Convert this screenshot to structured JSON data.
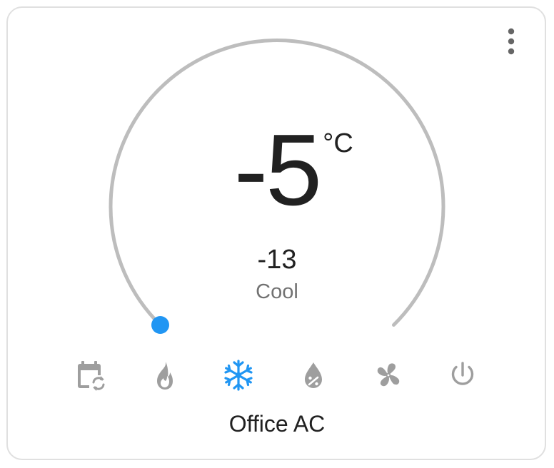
{
  "card": {
    "name": "Office AC"
  },
  "thermostat": {
    "target_temperature": "-5",
    "unit": "°C",
    "current_temperature": "-13",
    "mode_label": "Cool",
    "setpoint_fraction": 0.0
  },
  "modes": [
    {
      "id": "auto",
      "icon": "calendar-sync-icon",
      "active": false
    },
    {
      "id": "heat",
      "icon": "fire-icon",
      "active": false
    },
    {
      "id": "cool",
      "icon": "snowflake-icon",
      "active": true
    },
    {
      "id": "dry",
      "icon": "water-percent-icon",
      "active": false
    },
    {
      "id": "fan_only",
      "icon": "fan-icon",
      "active": false
    },
    {
      "id": "off",
      "icon": "power-icon",
      "active": false
    }
  ],
  "menu": {
    "icon": "dots-vertical-icon"
  },
  "colors": {
    "accent": "#2196f3",
    "track": "#bdbdbd",
    "inactive_icon": "#9e9e9e",
    "primary_text": "#212121",
    "secondary_text": "#727272",
    "border": "#e0e0e0"
  }
}
